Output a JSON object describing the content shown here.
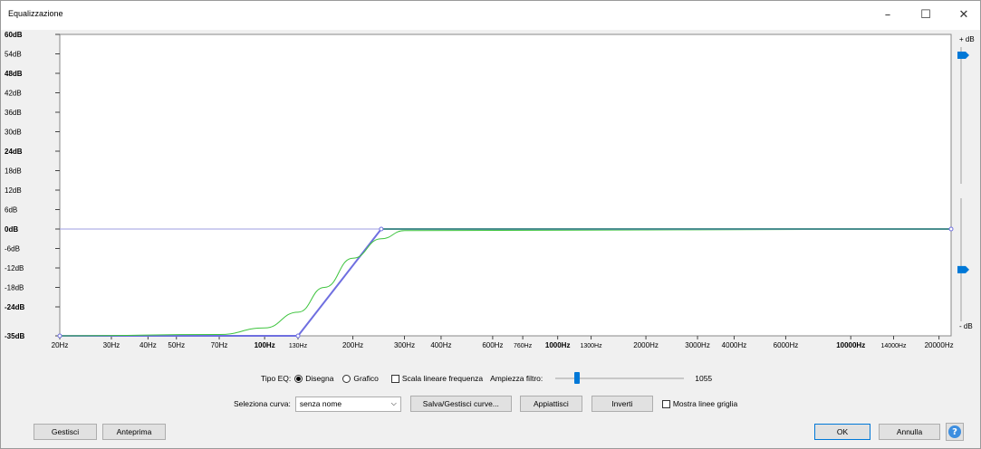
{
  "window": {
    "title": "Equalizzazione",
    "controls": {
      "minimize": "–",
      "maximize": "☐",
      "close": "✕"
    }
  },
  "graph": {
    "db_labels": [
      {
        "text": "60dB",
        "value": 60,
        "bold": true
      },
      {
        "text": "54dB",
        "value": 54,
        "bold": false
      },
      {
        "text": "48dB",
        "value": 48,
        "bold": true
      },
      {
        "text": "42dB",
        "value": 42,
        "bold": false
      },
      {
        "text": "36dB",
        "value": 36,
        "bold": false
      },
      {
        "text": "30dB",
        "value": 30,
        "bold": false
      },
      {
        "text": "24dB",
        "value": 24,
        "bold": true
      },
      {
        "text": "18dB",
        "value": 18,
        "bold": false
      },
      {
        "text": "12dB",
        "value": 12,
        "bold": false
      },
      {
        "text": "6dB",
        "value": 6,
        "bold": false
      },
      {
        "text": "0dB",
        "value": 0,
        "bold": true
      },
      {
        "text": "-6dB",
        "value": -6,
        "bold": false
      },
      {
        "text": "-12dB",
        "value": -12,
        "bold": false
      },
      {
        "text": "-18dB",
        "value": -18,
        "bold": false
      },
      {
        "text": "-24dB",
        "value": -24,
        "bold": true
      },
      {
        "text": "-35dB",
        "value": -35,
        "bold": true
      }
    ],
    "freq_labels": [
      {
        "text": "20Hz",
        "hz": 20,
        "bold": false,
        "small": false
      },
      {
        "text": "30Hz",
        "hz": 30,
        "bold": false,
        "small": false
      },
      {
        "text": "40Hz",
        "hz": 40,
        "bold": false,
        "small": false
      },
      {
        "text": "50Hz",
        "hz": 50,
        "bold": false,
        "small": false
      },
      {
        "text": "70Hz",
        "hz": 70,
        "bold": false,
        "small": false
      },
      {
        "text": "100Hz",
        "hz": 100,
        "bold": true,
        "small": false
      },
      {
        "text": "130Hz",
        "hz": 130,
        "bold": false,
        "small": true
      },
      {
        "text": "200Hz",
        "hz": 200,
        "bold": false,
        "small": false
      },
      {
        "text": "300Hz",
        "hz": 300,
        "bold": false,
        "small": false
      },
      {
        "text": "400Hz",
        "hz": 400,
        "bold": false,
        "small": false
      },
      {
        "text": "600Hz",
        "hz": 600,
        "bold": false,
        "small": false
      },
      {
        "text": "760Hz",
        "hz": 760,
        "bold": false,
        "small": true
      },
      {
        "text": "1000Hz",
        "hz": 1000,
        "bold": true,
        "small": false
      },
      {
        "text": "1300Hz",
        "hz": 1300,
        "bold": false,
        "small": true
      },
      {
        "text": "2000Hz",
        "hz": 2000,
        "bold": false,
        "small": false
      },
      {
        "text": "3000Hz",
        "hz": 3000,
        "bold": false,
        "small": false
      },
      {
        "text": "4000Hz",
        "hz": 4000,
        "bold": false,
        "small": false
      },
      {
        "text": "6000Hz",
        "hz": 6000,
        "bold": false,
        "small": false
      },
      {
        "text": "10000Hz",
        "hz": 10000,
        "bold": true,
        "small": false
      },
      {
        "text": "14000Hz",
        "hz": 14000,
        "bold": false,
        "small": true
      },
      {
        "text": "20000Hz",
        "hz": 20000,
        "bold": false,
        "small": false
      }
    ],
    "plus_db": "+ dB",
    "minus_db": "- dB",
    "colors": {
      "drawn_curve": "#6f6fe0",
      "smooth_curve": "#3ec43e",
      "zero_line": "#9c9ce0",
      "flat_curve": "#4a8f8f",
      "slider": "#0078d7"
    },
    "sliders": {
      "gain_level": 0.06,
      "zero_level": 0.58
    }
  },
  "chart_data": {
    "type": "line",
    "x_scale": "log",
    "xlim": [
      20,
      22000
    ],
    "ylim": [
      -35,
      60
    ],
    "xlabel": "",
    "ylabel": "",
    "series": [
      {
        "x": [
          20,
          130,
          250,
          22000
        ],
        "y": [
          -35,
          -35,
          0,
          0
        ]
      },
      {
        "x": [
          20,
          70,
          100,
          130,
          160,
          200,
          250,
          300,
          22000
        ],
        "y": [
          -35,
          -34.5,
          -32,
          -26,
          -18,
          -9,
          -3,
          -0.5,
          0
        ]
      }
    ]
  },
  "controls": {
    "tipo_eq_label": "Tipo EQ:",
    "disegna_label": "Disegna",
    "grafico_label": "Grafico",
    "scala_label": "Scala lineare frequenza",
    "ampiezza_label": "Ampiezza filtro:",
    "ampiezza_value": "1055",
    "ampiezza_fraction": 0.17,
    "seleziona_label": "Seleziona curva:",
    "curva_value": "senza nome",
    "salva_label": "Salva/Gestisci curve...",
    "appiattisci_label": "Appiattisci",
    "inverti_label": "Inverti",
    "griglia_label": "Mostra linee griglia"
  },
  "footer": {
    "gestisci_label": "Gestisci",
    "anteprima_label": "Anteprima",
    "ok_label": "OK",
    "annulla_label": "Annulla",
    "help_glyph": "?"
  }
}
